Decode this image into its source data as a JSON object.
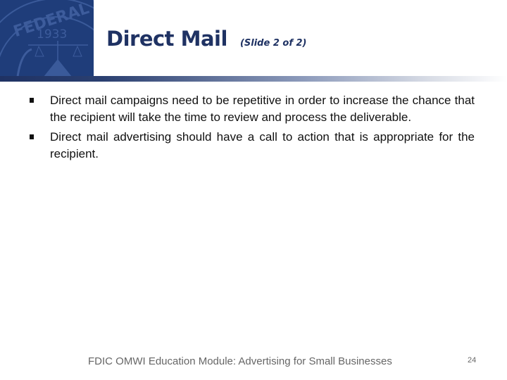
{
  "header": {
    "title": "Direct Mail",
    "subtitle": "(Slide 2 of 2)",
    "seal_text_top": "FEDERAL DEP",
    "seal_year": "1933"
  },
  "content": {
    "bullets": [
      "Direct mail campaigns need to be repetitive in order to increase the chance that the recipient will take the time to review and process the deliverable.",
      "Direct mail advertising should have a call to action that is appropriate for the recipient."
    ]
  },
  "footer": {
    "text": "FDIC OMWI Education Module:  Advertising for Small Businesses",
    "page_number": "24"
  },
  "colors": {
    "brand_navy": "#1f3263",
    "seal_blue": "#1f3d7a"
  }
}
